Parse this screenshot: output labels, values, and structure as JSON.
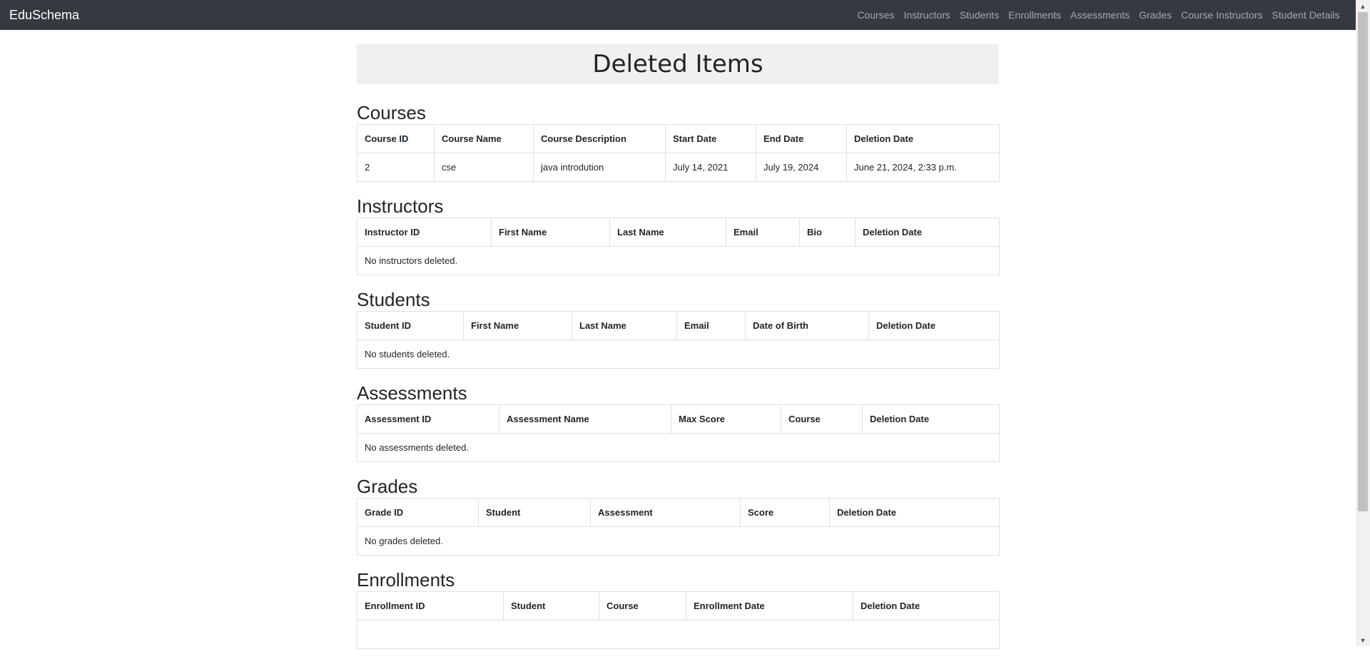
{
  "navbar": {
    "brand": "EduSchema",
    "links": [
      "Courses",
      "Instructors",
      "Students",
      "Enrollments",
      "Assessments",
      "Grades",
      "Course Instructors",
      "Student Details"
    ]
  },
  "page": {
    "title": "Deleted Items"
  },
  "sections": {
    "courses": {
      "heading": "Courses",
      "headers": [
        "Course ID",
        "Course Name",
        "Course Description",
        "Start Date",
        "End Date",
        "Deletion Date"
      ],
      "rows": [
        [
          "2",
          "cse",
          "java introdution",
          "July 14, 2021",
          "July 19, 2024",
          "June 21, 2024, 2:33 p.m."
        ]
      ]
    },
    "instructors": {
      "heading": "Instructors",
      "headers": [
        "Instructor ID",
        "First Name",
        "Last Name",
        "Email",
        "Bio",
        "Deletion Date"
      ],
      "empty": "No instructors deleted."
    },
    "students": {
      "heading": "Students",
      "headers": [
        "Student ID",
        "First Name",
        "Last Name",
        "Email",
        "Date of Birth",
        "Deletion Date"
      ],
      "empty": "No students deleted."
    },
    "assessments": {
      "heading": "Assessments",
      "headers": [
        "Assessment ID",
        "Assessment Name",
        "Max Score",
        "Course",
        "Deletion Date"
      ],
      "empty": "No assessments deleted."
    },
    "grades": {
      "heading": "Grades",
      "headers": [
        "Grade ID",
        "Student",
        "Assessment",
        "Score",
        "Deletion Date"
      ],
      "empty": "No grades deleted."
    },
    "enrollments": {
      "heading": "Enrollments",
      "headers": [
        "Enrollment ID",
        "Student",
        "Course",
        "Enrollment Date",
        "Deletion Date"
      ]
    }
  }
}
